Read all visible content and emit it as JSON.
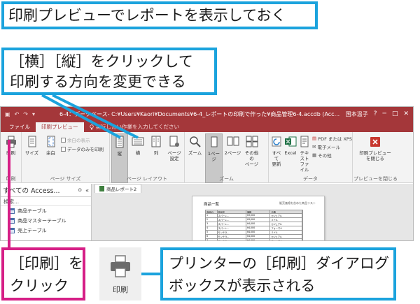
{
  "callouts": {
    "top": "印刷プレビューでレポートを表示しておく",
    "mid_line1": "［横］［縦］をクリックして",
    "mid_line2": "印刷する方向を変更できる",
    "print_line1": "［印刷］を",
    "print_line2": "クリック",
    "dialog_line1": "プリンターの［印刷］ダイアログ",
    "dialog_line2": "ボックスが表示される"
  },
  "colors": {
    "blue_callout": "#1ba3dd",
    "magenta_callout": "#d61f86",
    "access_brand": "#a4373a"
  },
  "window": {
    "title": "6-4：データベース- C:¥Users¥Kaori¥Documents¥6-4_レポートの印刷で作った¥商品管理6-4.accdb (Acc...",
    "user": "国本温子",
    "controls": [
      "?",
      "─",
      "□",
      "✕"
    ]
  },
  "tabs": [
    {
      "label": "ファイル"
    },
    {
      "label": "印刷プレビュー"
    }
  ],
  "tell_me": "実行したい作業を入力してください",
  "ribbon": {
    "print_group": {
      "button": "印刷",
      "label": "印刷"
    },
    "page_size_group": {
      "size": "サイズ",
      "margin": "余白",
      "show_margin": "余白の表示",
      "data_only": "データのみを印刷",
      "label": "ページ サイズ"
    },
    "layout_group": {
      "portrait": "縦",
      "landscape": "横",
      "columns": "列",
      "page_setup_1": "ページ",
      "page_setup_2": "設定",
      "label": "ページ レイアウト"
    },
    "zoom_group": {
      "zoom": "ズーム",
      "one_page": "1ページ",
      "two_page": "2ページ",
      "other_1": "その他の",
      "other_2": "ページ",
      "label": "ズーム"
    },
    "data_group": {
      "refresh_1": "すべて",
      "refresh_2": "更新",
      "excel": "Excel",
      "text_1": "テキスト",
      "text_2": "ファイル",
      "pdf": "PDF または XPS",
      "email": "電子メール",
      "more": "その他",
      "label": "データ"
    },
    "close_group": {
      "close_1": "印刷プレビュー",
      "close_2": "を閉じる",
      "label": "プレビューを閉じる"
    }
  },
  "nav": {
    "title": "すべての Access...",
    "search": "検索...",
    "items": [
      "商品テーブル",
      "商品マスターテーブル",
      "売上テーブル"
    ]
  },
  "doc_tab": "商品レポート2",
  "report": {
    "title": "商品一覧",
    "subtitle": "販売価格を含めた商品リスト",
    "header": [
      "商品ID",
      "商品名",
      "価格",
      "分類"
    ],
    "rows": [
      [
        "1",
        "スパーレ...",
        "¥3,000",
        "カジュアル"
      ],
      [
        "2",
        "スパーレ...",
        "¥3,000",
        "ミドル"
      ],
      [
        "3",
        "スパーレ...",
        "¥4,000",
        "カジュアル"
      ],
      [
        "4",
        "スパーレ...",
        "¥4,000",
        "フォーマル"
      ],
      [
        "5",
        "モンテラ...",
        "¥4,000",
        "ミドル"
      ],
      [
        "6",
        "モンテラ...",
        "¥4,000",
        "カジュアル"
      ],
      [
        "7",
        "モンテラ...",
        "¥4,000",
        "フォーマル"
      ]
    ]
  },
  "print_icon_label": "印刷"
}
